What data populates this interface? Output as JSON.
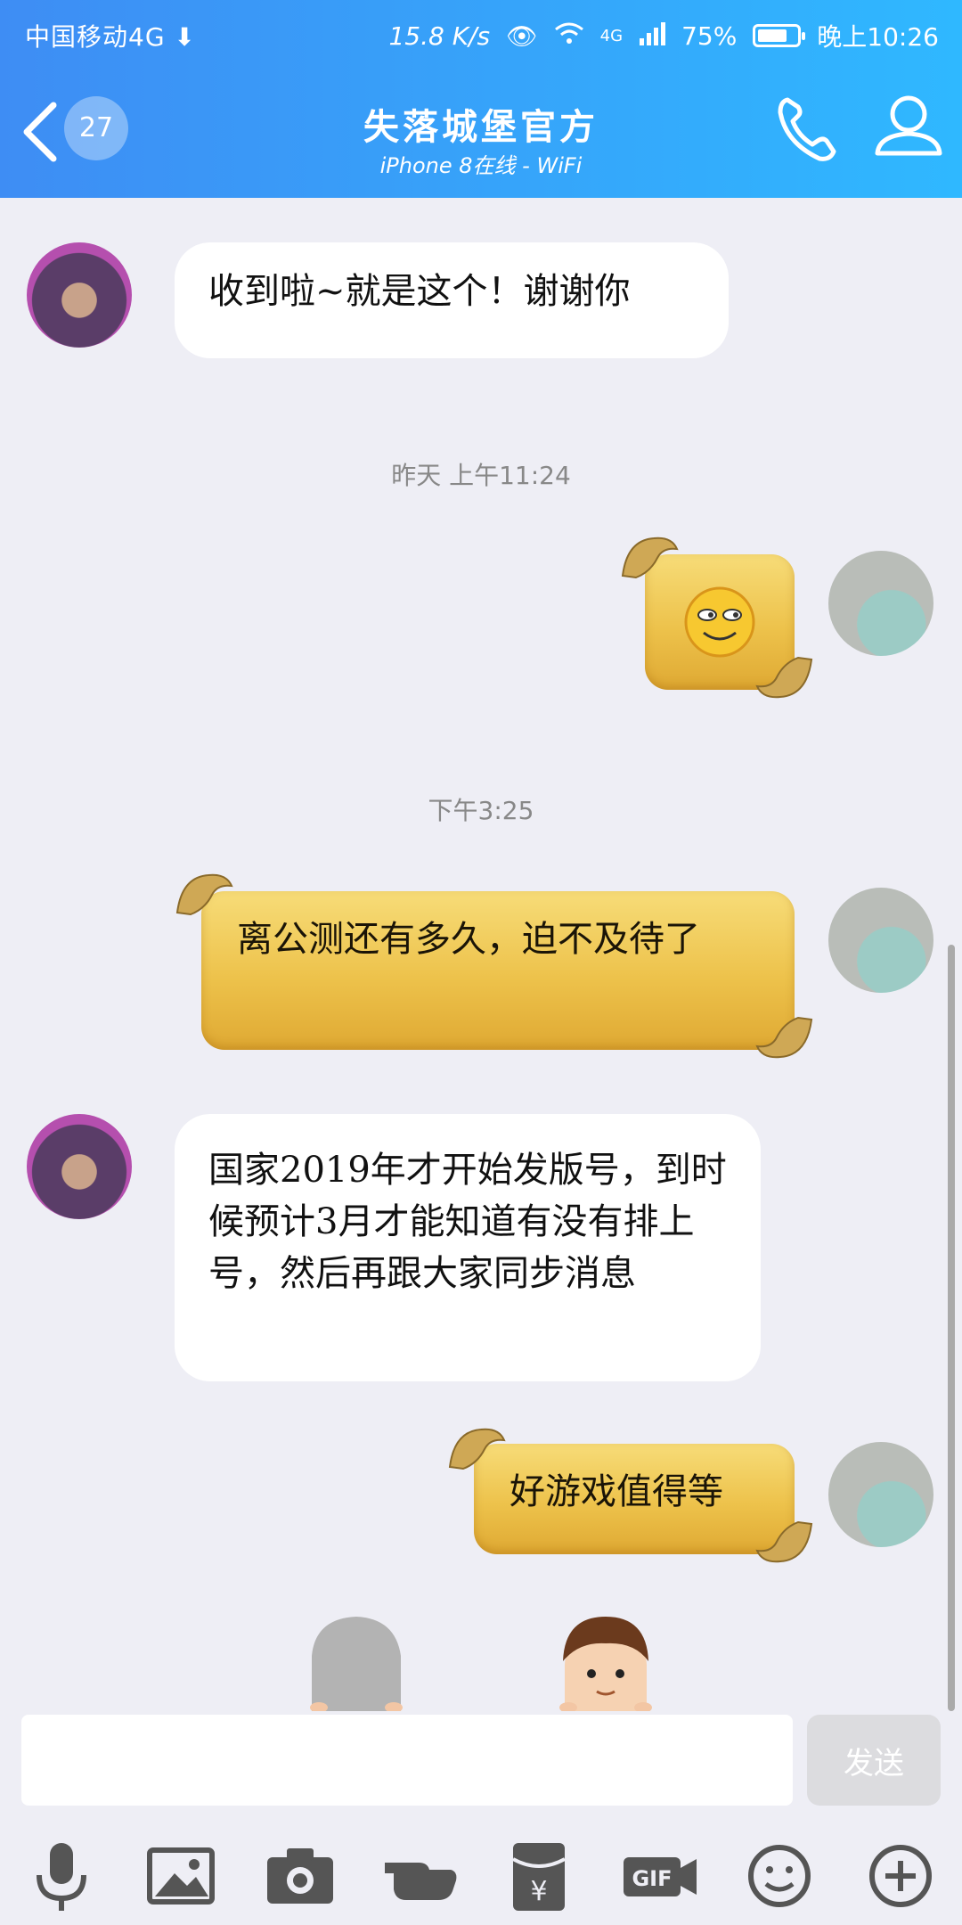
{
  "status": {
    "carrier": "中国移动4G",
    "speed": "15.8 K/s",
    "network": "4G",
    "battery": "75%",
    "time": "晚上10:26"
  },
  "nav": {
    "unread_count": "27",
    "title": "失落城堡官方",
    "subtitle": "iPhone 8在线 - WiFi"
  },
  "messages": {
    "m1": "收到啦~就是这个！谢谢你",
    "ts1": "昨天 上午11:24",
    "ts2": "下午3:25",
    "m2": "离公测还有多久，迫不及待了",
    "m3": "国家2019年才开始发版号，到时候预计3月才能知道有没有排上号，然后再跟大家同步消息",
    "m4": "好游戏值得等"
  },
  "composer": {
    "input_value": "",
    "send_label": "发送"
  },
  "toolbar": [
    "microphone-icon",
    "image-icon",
    "camera-icon",
    "poke-hand-icon",
    "red-packet-icon",
    "gif-icon",
    "emoji-icon",
    "plus-icon"
  ],
  "colors": {
    "header_start": "#3e8df4",
    "header_end": "#2fb8ff",
    "bubble_gold": "#edc24b"
  }
}
